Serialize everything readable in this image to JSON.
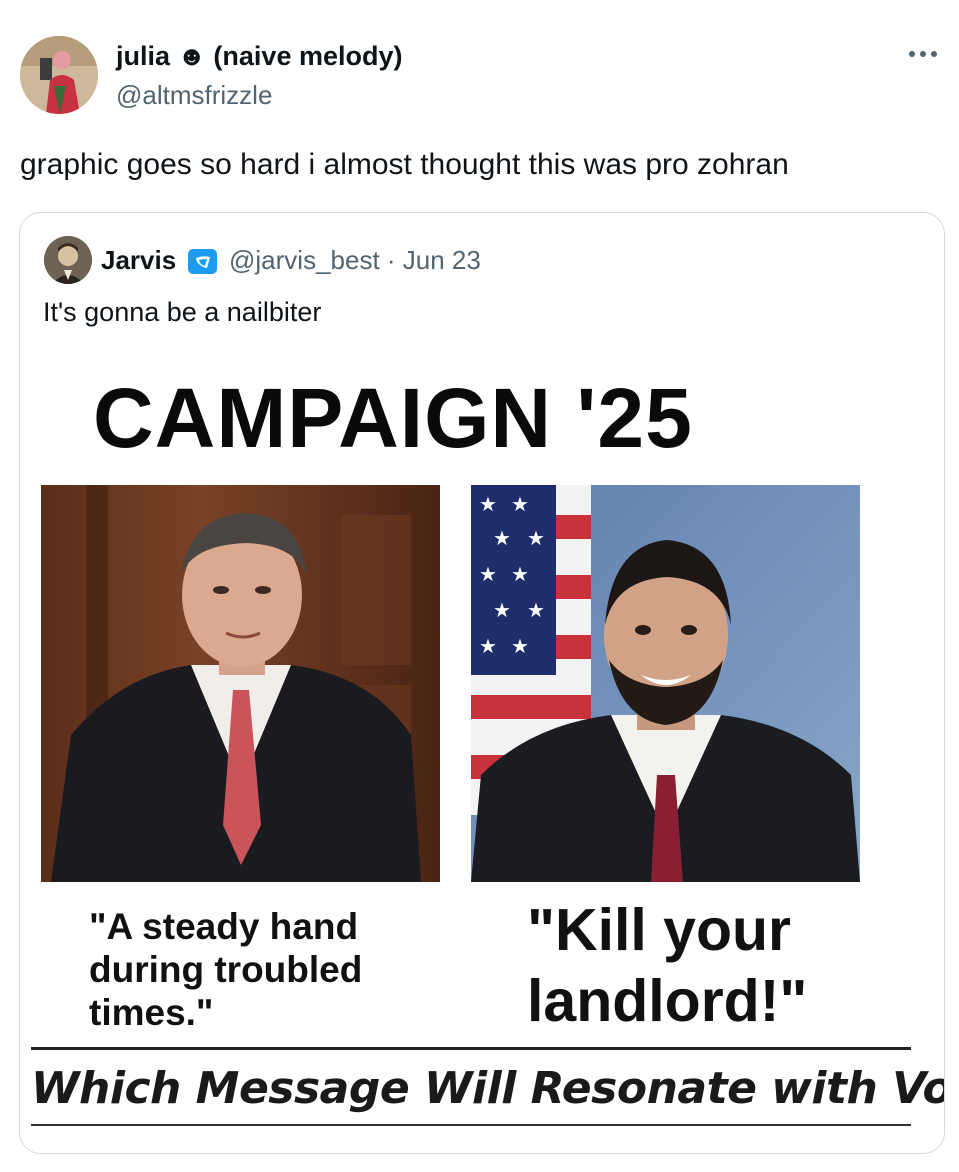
{
  "post": {
    "author": {
      "display_name": "julia ☻ (naive melody)",
      "handle": "@altmsfrizzle"
    },
    "text": "graphic goes so hard i almost thought this was pro zohran"
  },
  "quoted_post": {
    "author": {
      "display_name": "Jarvis",
      "handle": "@jarvis_best · Jun 23",
      "verified_color": "#1d9bf0"
    },
    "text": "It's gonna be a nailbiter",
    "graphic": {
      "title": "CAMPAIGN '25",
      "left_caption": "\"A steady hand\nduring troubled\ntimes.\"",
      "right_caption": "\"Kill your\nlandlord!\"",
      "footer": "Which Message Will Resonate with Voters?"
    }
  },
  "icons": {
    "more": "more-horizontal-icon",
    "verified": "verified-badge-icon"
  }
}
